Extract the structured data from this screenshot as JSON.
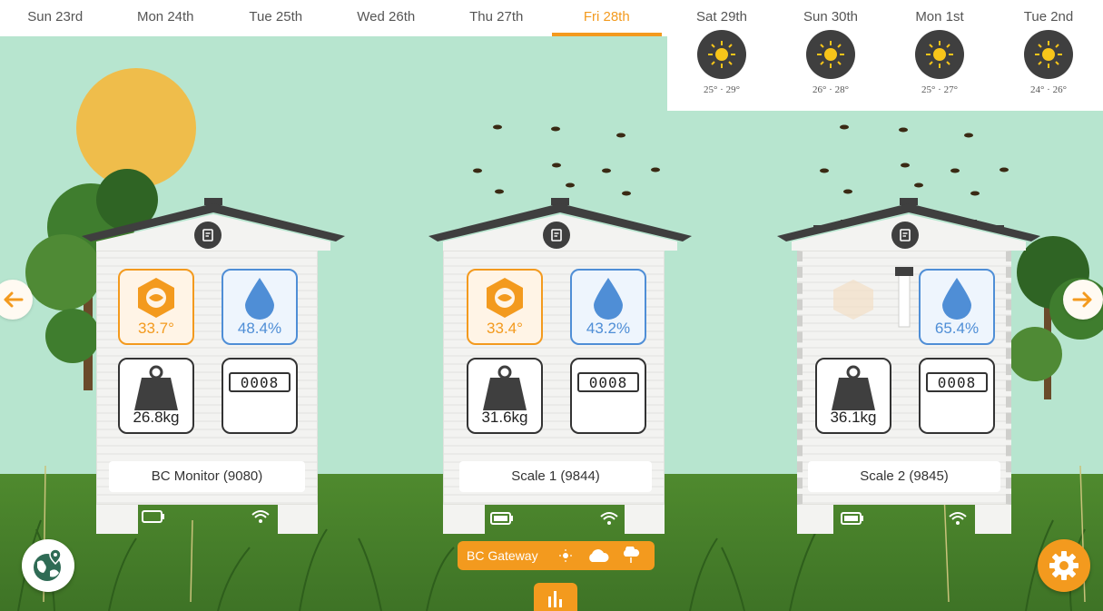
{
  "dates": [
    {
      "label": "Sun 23rd",
      "active": false
    },
    {
      "label": "Mon 24th",
      "active": false
    },
    {
      "label": "Tue 25th",
      "active": false
    },
    {
      "label": "Wed 26th",
      "active": false
    },
    {
      "label": "Thu 27th",
      "active": false
    },
    {
      "label": "Fri 28th",
      "active": true
    }
  ],
  "forecast": [
    {
      "label": "Sat 29th",
      "temps": "25° · 29°",
      "icon": "sun-icon"
    },
    {
      "label": "Sun 30th",
      "temps": "26° · 28°",
      "icon": "sun-icon"
    },
    {
      "label": "Mon 1st",
      "temps": "25° · 27°",
      "icon": "sun-icon"
    },
    {
      "label": "Tue 2nd",
      "temps": "24° · 26°",
      "icon": "sun-icon"
    }
  ],
  "hives": [
    {
      "name": "BC Monitor (9080)",
      "temperature": "33.7°",
      "humidity": "48.4%",
      "weight": "26.8kg",
      "counter": "0008",
      "battery": "low"
    },
    {
      "name": "Scale 1 (9844)",
      "temperature": "33.4°",
      "humidity": "43.2%",
      "weight": "31.6kg",
      "counter": "0008",
      "battery": "full"
    },
    {
      "name": "Scale 2 (9845)",
      "temperature": "",
      "humidity": "65.4%",
      "weight": "36.1kg",
      "counter": "0008",
      "battery": "full"
    }
  ],
  "gateway": {
    "label": "BC Gateway"
  },
  "colors": {
    "accent": "#f39a1e",
    "humidity": "#4f8ed6",
    "sky": "#b7e5cf",
    "sun": "#efbd4b",
    "grass": "#4f8a2e",
    "roof": "#3f3f3f"
  },
  "icons": {
    "nav_left": "arrow-left-icon",
    "nav_right": "arrow-right-icon",
    "map": "globe-location-icon",
    "settings": "gear-icon",
    "stats": "bar-chart-icon",
    "gateway_status": [
      "sun-icon",
      "cloud-icon",
      "rain-cloud-icon"
    ]
  }
}
